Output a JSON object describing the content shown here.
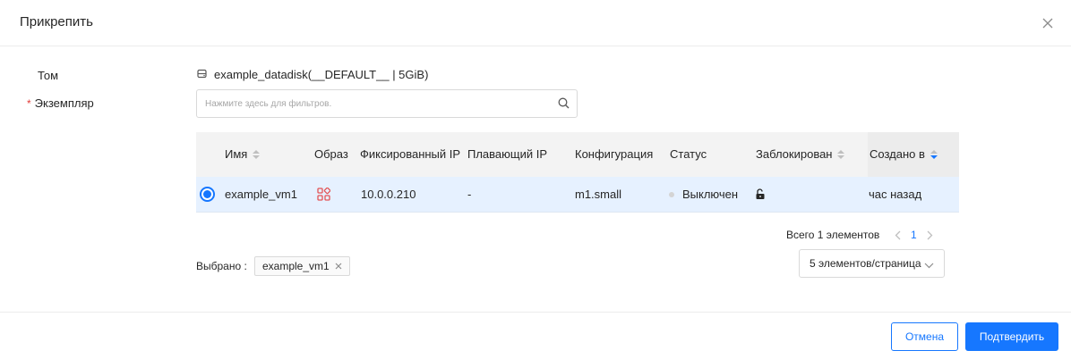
{
  "modal": {
    "title": "Прикрепить",
    "close_icon": "close-icon"
  },
  "form": {
    "volume_label": "Том",
    "volume_icon": "disk-icon",
    "volume_value": "example_datadisk(__DEFAULT__ | 5GiB)",
    "instance_label": "Экземпляр",
    "required_mark": "*",
    "search_placeholder": "Нажмите здесь для фильтров.",
    "search_icon": "search-icon"
  },
  "table": {
    "columns": {
      "name": "Имя",
      "image": "Образ",
      "fixed_ip": "Фиксированный IP",
      "floating_ip": "Плавающий IP",
      "flavor": "Конфигурация",
      "status": "Статус",
      "locked": "Заблокирован",
      "created": "Создано в"
    },
    "rows": [
      {
        "selected": true,
        "name": "example_vm1",
        "image_icon": "image-os-icon",
        "fixed_ip": "10.0.0.210",
        "floating_ip": "-",
        "flavor": "m1.small",
        "status": "Выключен",
        "locked_icon": "unlock-icon",
        "created": "час назад"
      }
    ]
  },
  "pagination": {
    "total": "Всего 1 элементов",
    "current_page": "1",
    "page_size": "5 элементов/страница"
  },
  "selection": {
    "label": "Выбрано :",
    "tag": "example_vm1"
  },
  "footer": {
    "cancel": "Отмена",
    "confirm": "Подтвердить"
  },
  "colors": {
    "accent": "#1677ff",
    "required": "#e23c39",
    "selected_row": "#e6f1ff",
    "image_icon": "#e45456"
  }
}
